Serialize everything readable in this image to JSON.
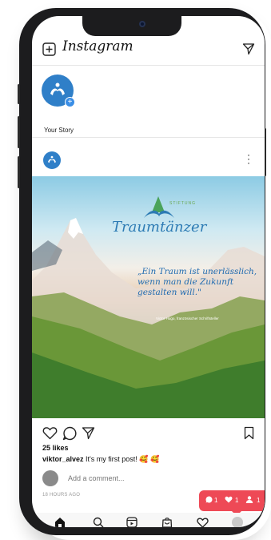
{
  "app": {
    "title": "Instagram"
  },
  "stories": [
    {
      "label": "Your Story"
    }
  ],
  "post": {
    "image": {
      "brand": "Traumtänzer",
      "brand_small": "STIFTUNG",
      "quote": "„Ein Traum ist unerlässlich, wenn man die Zukunft gestalten will.\"",
      "author": "Victor Hugo, französischer Schriftsteller"
    },
    "likes": "25 likes",
    "caption": {
      "username": "viktor_alvez",
      "text": "It's my first post! 🥰 🥰"
    },
    "comment_placeholder": "Add a comment...",
    "timestamp": "18 HOURS AGO"
  },
  "notifications": {
    "comments": "1",
    "likes": "1",
    "follows": "1"
  },
  "colors": {
    "accent": "#ee4956",
    "brand_blue": "#2f7fc8"
  }
}
